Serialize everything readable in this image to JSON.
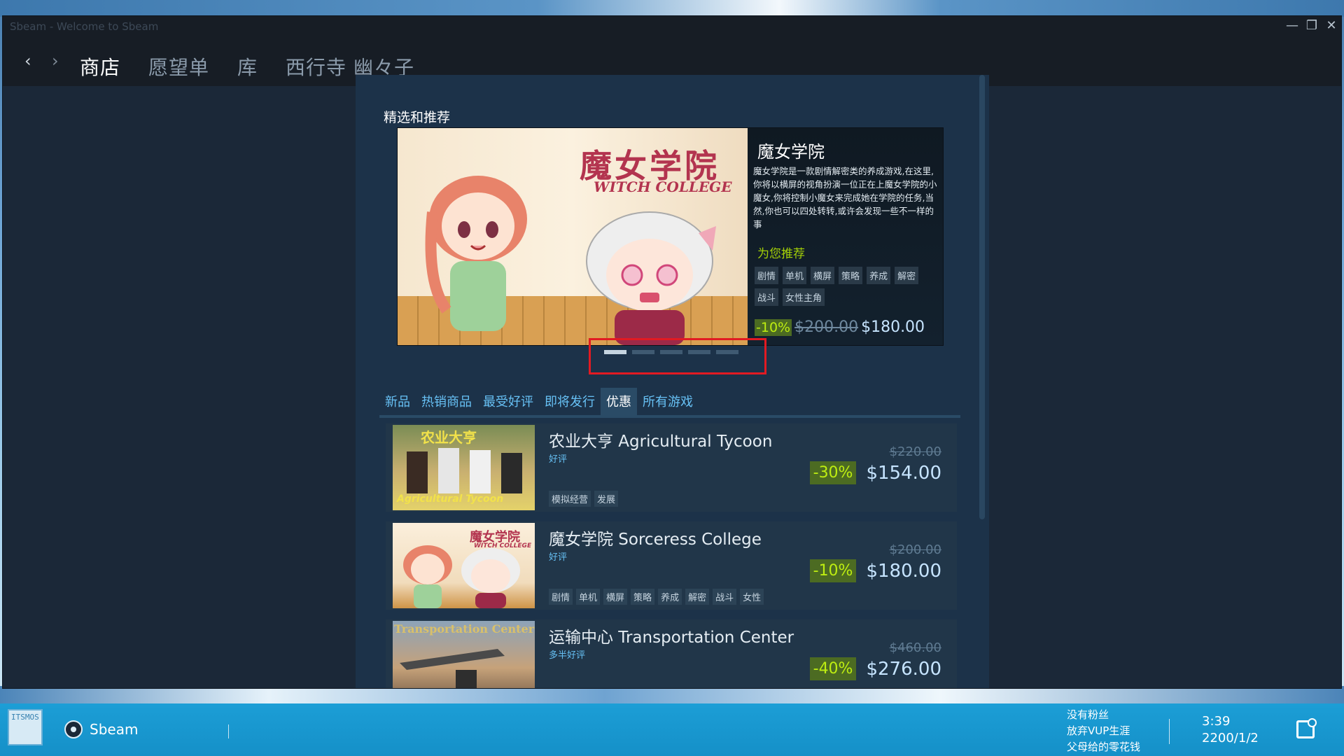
{
  "window": {
    "title": "Sbeam - Welcome to Sbeam",
    "controls": [
      "—",
      "❐",
      "✕"
    ]
  },
  "nav": {
    "back_icon": "‹",
    "forward_icon": "›",
    "links": [
      "商店",
      "愿望单",
      "库",
      "西行寺 幽々子"
    ]
  },
  "featured": {
    "section_title": "精选和推荐",
    "image_logo": "魔女学院",
    "image_logo_sub": "WITCH COLLEGE",
    "game_title": "魔女学院",
    "description": "魔女学院是一款剧情解密类的养成游戏,在这里,你将以横屏的视角扮演一位正在上魔女学院的小魔女,你将控制小魔女来完成她在学院的任务,当然,你也可以四处转转,或许会发现一些不一样的事",
    "reason": "为您推荐",
    "tags": [
      "剧情",
      "单机",
      "横屏",
      "策略",
      "养成",
      "解密",
      "战斗",
      "女性主角"
    ],
    "discount": "-10%",
    "original_price": "$200.00",
    "final_price": "$180.00",
    "carousel_pages": 5,
    "carousel_active": 0
  },
  "tabs": [
    "新品",
    "热销商品",
    "最受好评",
    "即将发行",
    "优惠",
    "所有游戏"
  ],
  "active_tab": "优惠",
  "games": [
    {
      "title": "农业大亨 Agricultural Tycoon",
      "review": "好评",
      "tags": [
        "模拟经营",
        "发展"
      ],
      "image_text": "农业大亨",
      "image_sub": "Agricultural Tycoon",
      "discount": "-30%",
      "original_price": "$220.00",
      "final_price": "$154.00"
    },
    {
      "title": "魔女学院 Sorceress College",
      "review": "好评",
      "tags": [
        "剧情",
        "单机",
        "横屏",
        "策略",
        "养成",
        "解密",
        "战斗",
        "女性"
      ],
      "image_text": "魔女学院",
      "image_sub": "WITCH COLLEGE",
      "discount": "-10%",
      "original_price": "$200.00",
      "final_price": "$180.00"
    },
    {
      "title": "运输中心 Transportation Center",
      "review": "多半好评",
      "tags": [],
      "image_text": "Transportation Center",
      "image_sub": "",
      "discount": "-40%",
      "original_price": "$460.00",
      "final_price": "$276.00"
    }
  ],
  "taskbar": {
    "os_logo": "ITSMOS",
    "app_label": "Sbeam",
    "notification_lines": [
      "没有粉丝",
      "放弃VUP生涯",
      "父母给的零花钱"
    ],
    "time": "3:39",
    "date": "2200/1/2"
  },
  "colors": {
    "window_bg": "#1b2838",
    "store_bg": "#1c3249",
    "accent_link": "#67c1f5",
    "discount_bg": "#4c6b22",
    "discount_text": "#beee11",
    "highlight_box": "#e21a22",
    "taskbar": "#1590c8"
  }
}
